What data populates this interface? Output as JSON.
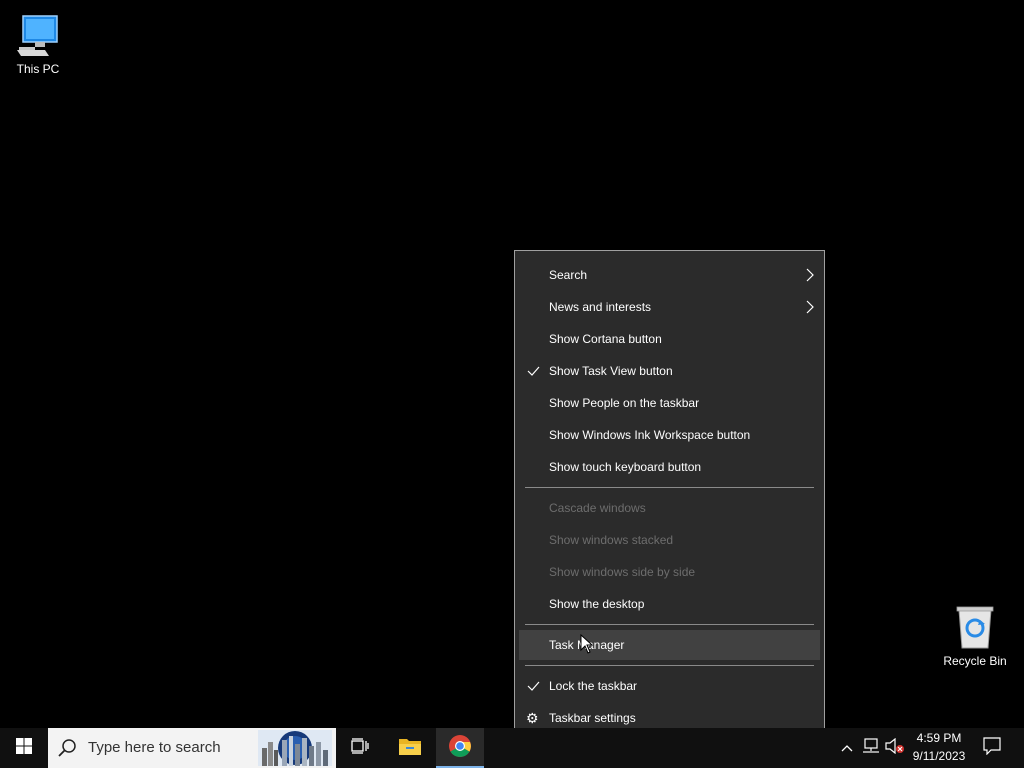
{
  "desktop": {
    "this_pc": "This PC",
    "recycle_bin": "Recycle Bin"
  },
  "context_menu": {
    "items": [
      {
        "label": "Search",
        "submenu": true,
        "enabled": true
      },
      {
        "label": "News and interests",
        "submenu": true,
        "enabled": true
      },
      {
        "label": "Show Cortana button",
        "enabled": true
      },
      {
        "label": "Show Task View button",
        "checked": true,
        "enabled": true
      },
      {
        "label": "Show People on the taskbar",
        "enabled": true
      },
      {
        "label": "Show Windows Ink Workspace button",
        "enabled": true
      },
      {
        "label": "Show touch keyboard button",
        "enabled": true
      },
      {
        "label": "Cascade windows",
        "enabled": false
      },
      {
        "label": "Show windows stacked",
        "enabled": false
      },
      {
        "label": "Show windows side by side",
        "enabled": false
      },
      {
        "label": "Show the desktop",
        "enabled": true
      },
      {
        "label": "Task Manager",
        "enabled": true,
        "hovered": true
      },
      {
        "label": "Lock the taskbar",
        "checked": true,
        "enabled": true
      },
      {
        "label": "Taskbar settings",
        "icon": "gear-icon",
        "enabled": true
      }
    ]
  },
  "taskbar": {
    "search_placeholder": "Type here to search",
    "pinned": [
      "start-icon",
      "task-view-icon",
      "file-explorer-icon",
      "chrome-icon"
    ],
    "tray_icons": [
      "chevron-up-icon",
      "network-icon",
      "volume-muted-icon",
      "notification-icon"
    ],
    "time": "4:59 PM",
    "date": "9/11/2023"
  },
  "colors": {
    "menu_bg": "#2b2b2b",
    "menu_hover": "#414141",
    "disabled_text": "#6d6d6d",
    "taskbar_bg": "#101010",
    "active_app_underline": "#7eb4ea"
  }
}
